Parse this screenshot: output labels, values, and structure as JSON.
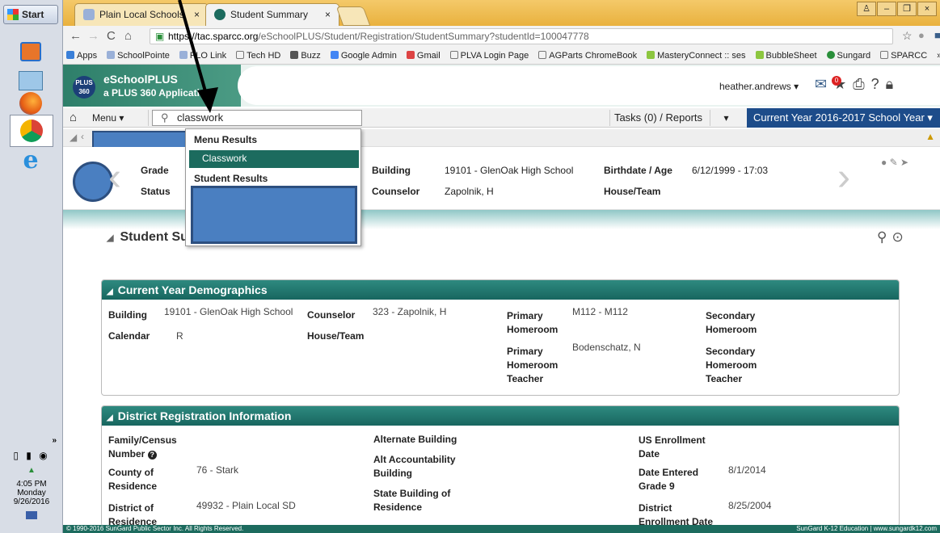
{
  "taskbar": {
    "start_label": "Start",
    "tray_clock": "4:05 PM",
    "tray_day": "Monday",
    "tray_date": "9/26/2016",
    "overflow": "»"
  },
  "browser": {
    "tabs": [
      {
        "label": "Plain Local Schools"
      },
      {
        "label": "Student Summary"
      }
    ],
    "url_host": "https://tac.sparcc.org",
    "url_path": "/eSchoolPLUS/Student/Registration/StudentSummary?studentId=100047778",
    "bookmarks": [
      "Apps",
      "SchoolPointe",
      "PLO Link",
      "Tech HD",
      "Buzz",
      "Google Admin",
      "Gmail",
      "PLVA Login Page",
      "AGParts ChromeBook",
      "MasteryConnect :: ses",
      "BubbleSheet",
      "Sungard",
      "SPARCC",
      "»"
    ]
  },
  "app": {
    "logo_text": "PLUS 360",
    "title": "eSchoolPLUS",
    "subtitle": "a PLUS 360 Application",
    "user": "heather.andrews ▾",
    "mail_count": "0"
  },
  "menubar": {
    "menu_label": "Menu ▾",
    "search_value": "classwork",
    "tasks_label": "Tasks (0) / Reports",
    "year_label": "Current Year 2016-2017 School Year ▾"
  },
  "dropdown": {
    "menu_results": "Menu Results",
    "menu_item": "Classwork",
    "student_results": "Student Results"
  },
  "student_header": {
    "grade_label": "Grade",
    "status_label": "Status",
    "building_label": "Building",
    "building_value": "19101 - GlenOak High School",
    "counselor_label": "Counselor",
    "counselor_value": "Zapolnik, H",
    "birthdate_label": "Birthdate / Age",
    "birthdate_value": "6/12/1999 - 17:03",
    "house_label": "House/Team"
  },
  "page_title": "Student Su",
  "demographics": {
    "title": "Current Year Demographics",
    "building_label": "Building",
    "building_value": "19101 - GlenOak High School",
    "counselor_label": "Counselor",
    "counselor_value": "323 - Zapolnik, H",
    "primary_hr_label": "Primary Homeroom",
    "primary_hr_value": "M112 - M112",
    "secondary_hr_label": "Secondary Homeroom",
    "calendar_label": "Calendar",
    "calendar_value": "R",
    "house_label": "House/Team",
    "primary_teacher_label": "Primary Homeroom Teacher",
    "primary_teacher_value": "Bodenschatz, N",
    "secondary_teacher_label": "Secondary Homeroom Teacher"
  },
  "district": {
    "title": "District Registration Information",
    "family_label": "Family/Census Number",
    "county_label": "County of Residence",
    "county_value": "76 - Stark",
    "district_label": "District of Residence",
    "district_value": "49932 - Plain Local SD",
    "alt_building_label": "Alternate Building",
    "alt_account_label": "Alt Accountability Building",
    "state_building_label": "State Building of Residence",
    "us_enroll_label": "US Enrollment Date",
    "grade9_label": "Date Entered Grade 9",
    "grade9_value": "8/1/2014",
    "district_enroll_label": "District Enrollment Date",
    "district_enroll_value": "8/25/2004"
  },
  "footer": {
    "left": "© 1990-2016 SunGard Public Sector Inc. All Rights Reserved.",
    "right": "SunGard K-12 Education | www.sungardk12.com"
  }
}
